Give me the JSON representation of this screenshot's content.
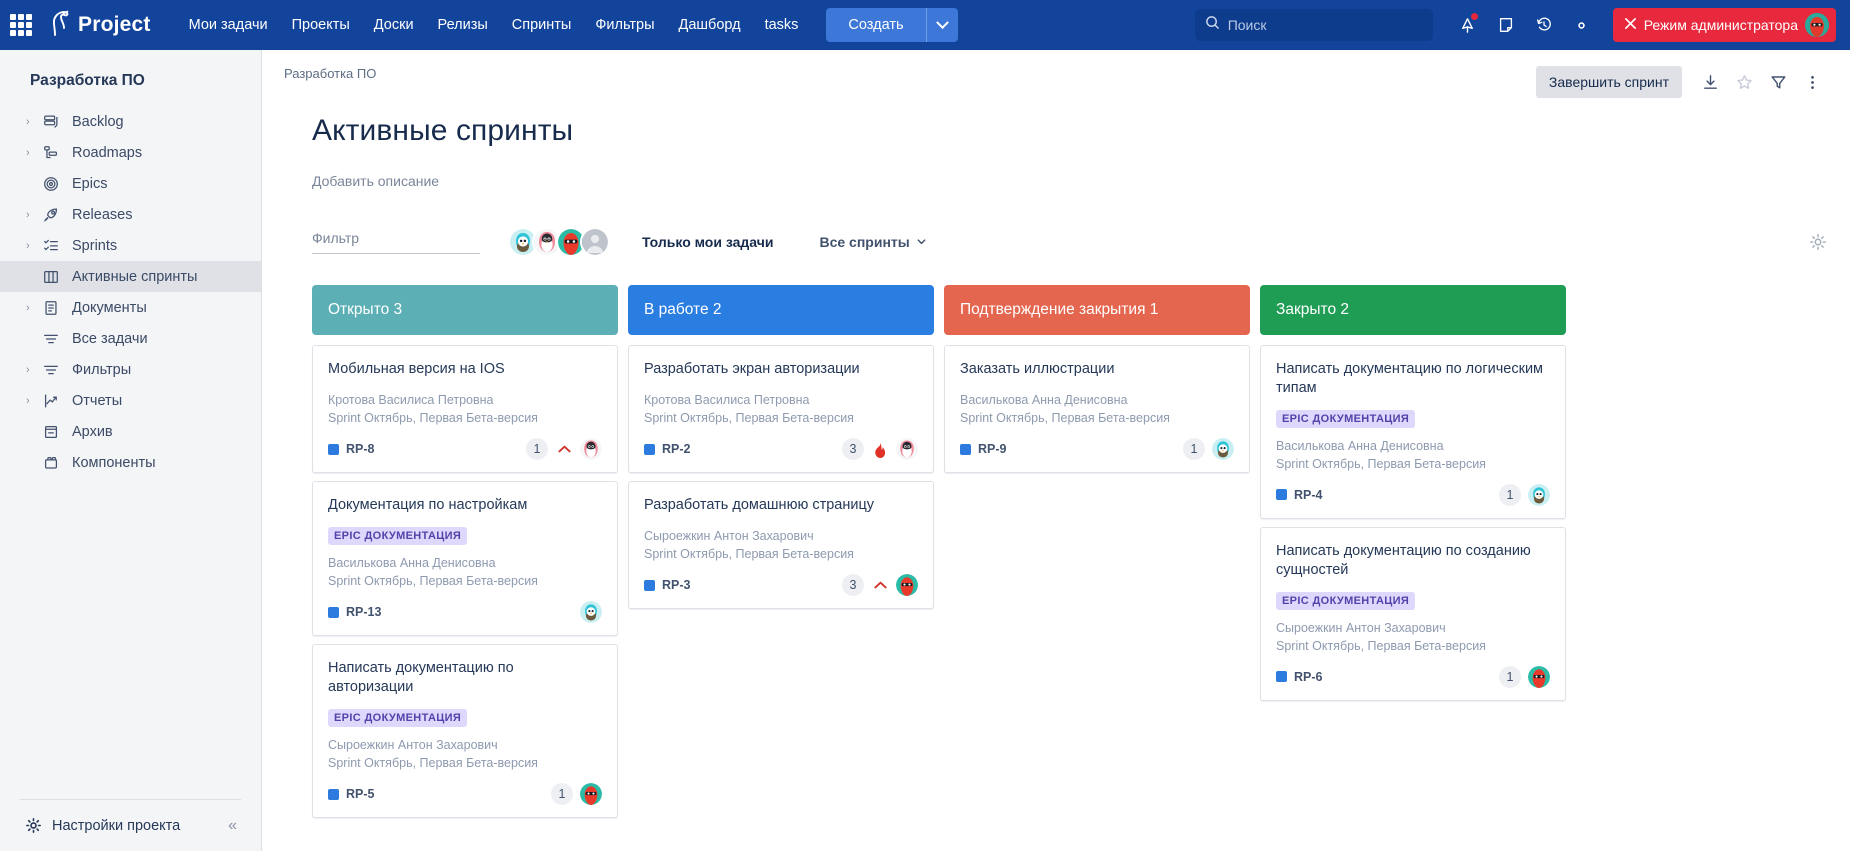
{
  "topbar": {
    "apps_icon": "grid-apps-icon",
    "brand": "Project",
    "nav": [
      {
        "label": "Мои задачи"
      },
      {
        "label": "Проекты"
      },
      {
        "label": "Доски"
      },
      {
        "label": "Релизы"
      },
      {
        "label": "Спринты"
      },
      {
        "label": "Фильтры"
      },
      {
        "label": "Дашборд"
      },
      {
        "label": "tasks"
      }
    ],
    "create_label": "Создать",
    "create_caret_icon": "chevron-down-icon",
    "search": {
      "placeholder": "Поиск",
      "value": "",
      "icon": "search-icon"
    },
    "icons": [
      {
        "name": "notifications-icon"
      },
      {
        "name": "note-icon"
      },
      {
        "name": "history-icon"
      },
      {
        "name": "gear-icon"
      }
    ],
    "admin_label": "Режим администратора",
    "admin_close_icon": "close-icon",
    "accent_blue": "#12449B",
    "create_blue": "#3D78D8",
    "admin_red": "#E8283C"
  },
  "sidebar": {
    "project_title": "Разработка ПО",
    "items": [
      {
        "label": "Backlog",
        "icon": "backlog-icon",
        "expandable": true,
        "active": false
      },
      {
        "label": "Roadmaps",
        "icon": "roadmap-icon",
        "expandable": true,
        "active": false
      },
      {
        "label": "Epics",
        "icon": "epics-target-icon",
        "expandable": false,
        "active": false
      },
      {
        "label": "Releases",
        "icon": "rocket-icon",
        "expandable": true,
        "active": false
      },
      {
        "label": "Sprints",
        "icon": "checklist-icon",
        "expandable": true,
        "active": false
      },
      {
        "label": "Активные спринты",
        "icon": "board-columns-icon",
        "expandable": false,
        "active": true
      },
      {
        "label": "Документы",
        "icon": "document-icon",
        "expandable": true,
        "active": false
      },
      {
        "label": "Все задачи",
        "icon": "filter-lines-icon",
        "expandable": false,
        "active": false
      },
      {
        "label": "Фильтры",
        "icon": "filter-lines-icon",
        "expandable": true,
        "active": false
      },
      {
        "label": "Отчеты",
        "icon": "chart-line-icon",
        "expandable": false,
        "active": false
      },
      {
        "label": "Архив",
        "icon": "archive-icon",
        "expandable": false,
        "active": false
      },
      {
        "label": "Компоненты",
        "icon": "components-icon",
        "expandable": false,
        "active": false
      }
    ],
    "settings_label": "Настройки проекта",
    "settings_icon": "gear-icon",
    "collapse_icon": "double-chevron-left-icon"
  },
  "main": {
    "breadcrumb": "Разработка ПО",
    "finish_sprint_label": "Завершить спринт",
    "head_icons": [
      {
        "name": "download-icon"
      },
      {
        "name": "star-icon"
      },
      {
        "name": "filter-funnel-icon"
      },
      {
        "name": "more-vertical-icon"
      }
    ],
    "page_title": "Активные спринты",
    "page_description": "Добавить описание",
    "filter": {
      "placeholder": "Фильтр",
      "value": ""
    },
    "avatars": [
      {
        "name": "avatar-bird-teal"
      },
      {
        "name": "avatar-penguin-pink"
      },
      {
        "name": "avatar-ninja-red"
      },
      {
        "name": "avatar-default-gray"
      }
    ],
    "only_my_tasks_label": "Только мои задачи",
    "all_sprints_label": "Все спринты",
    "all_sprints_caret_icon": "chevron-down-icon",
    "board_settings_icon": "gear-icon"
  },
  "board": {
    "columns": [
      {
        "title": "Открыто 3",
        "color": "#5BAFB5",
        "cards": [
          {
            "title": "Мобильная версия на IOS",
            "epic": null,
            "assignee": "Кротова Василиса Петровна",
            "sprint": "Sprint Октябрь, Первая Бета-версия",
            "key": "RP-8",
            "count": "1",
            "priority": "chevron-up-red-icon",
            "avatar": "avatar-penguin-pink"
          },
          {
            "title": "Документация по настройкам",
            "epic": "EPIC ДОКУМЕНТАЦИЯ",
            "assignee": "Василькова Анна Денисовна",
            "sprint": "Sprint Октябрь, Первая Бета-версия",
            "key": "RP-13",
            "count": null,
            "priority": null,
            "avatar": "avatar-bird-teal"
          },
          {
            "title": "Написать документацию по авторизации",
            "epic": "EPIC ДОКУМЕНТАЦИЯ",
            "assignee": "Сыроежкин Антон Захарович",
            "sprint": "Sprint Октябрь, Первая Бета-версия",
            "key": "RP-5",
            "count": "1",
            "priority": null,
            "avatar": "avatar-ninja-red"
          }
        ]
      },
      {
        "title": "В работе 2",
        "color": "#2A7DE1",
        "cards": [
          {
            "title": "Разработать экран авторизации",
            "epic": null,
            "assignee": "Кротова Василиса Петровна",
            "sprint": "Sprint Октябрь, Первая Бета-версия",
            "key": "RP-2",
            "count": "3",
            "priority": "fire-red-icon",
            "avatar": "avatar-penguin-pink"
          },
          {
            "title": "Разработать домашнюю страницу",
            "epic": null,
            "assignee": "Сыроежкин Антон Захарович",
            "sprint": "Sprint Октябрь, Первая Бета-версия",
            "key": "RP-3",
            "count": "3",
            "priority": "chevron-up-red-icon",
            "avatar": "avatar-ninja-red"
          }
        ]
      },
      {
        "title": "Подтверждение закрытия 1",
        "color": "#E4664F",
        "cards": [
          {
            "title": "Заказать иллюстрации",
            "epic": null,
            "assignee": "Василькова Анна Денисовна",
            "sprint": "Sprint Октябрь, Первая Бета-версия",
            "key": "RP-9",
            "count": "1",
            "priority": null,
            "avatar": "avatar-bird-teal"
          }
        ]
      },
      {
        "title": "Закрыто 2",
        "color": "#1F9D55",
        "cards": [
          {
            "title": "Написать документацию по логическим типам",
            "epic": "EPIC ДОКУМЕНТАЦИЯ",
            "assignee": "Василькова Анна Денисовна",
            "sprint": "Sprint Октябрь, Первая Бета-версия",
            "key": "RP-4",
            "count": "1",
            "priority": null,
            "avatar": "avatar-bird-teal"
          },
          {
            "title": "Написать документацию по созданию сущностей",
            "epic": "EPIC ДОКУМЕНТАЦИЯ",
            "assignee": "Сыроежкин Антон Захарович",
            "sprint": "Sprint Октябрь, Первая Бета-версия",
            "key": "RP-6",
            "count": "1",
            "priority": null,
            "avatar": "avatar-ninja-red"
          }
        ]
      }
    ]
  }
}
